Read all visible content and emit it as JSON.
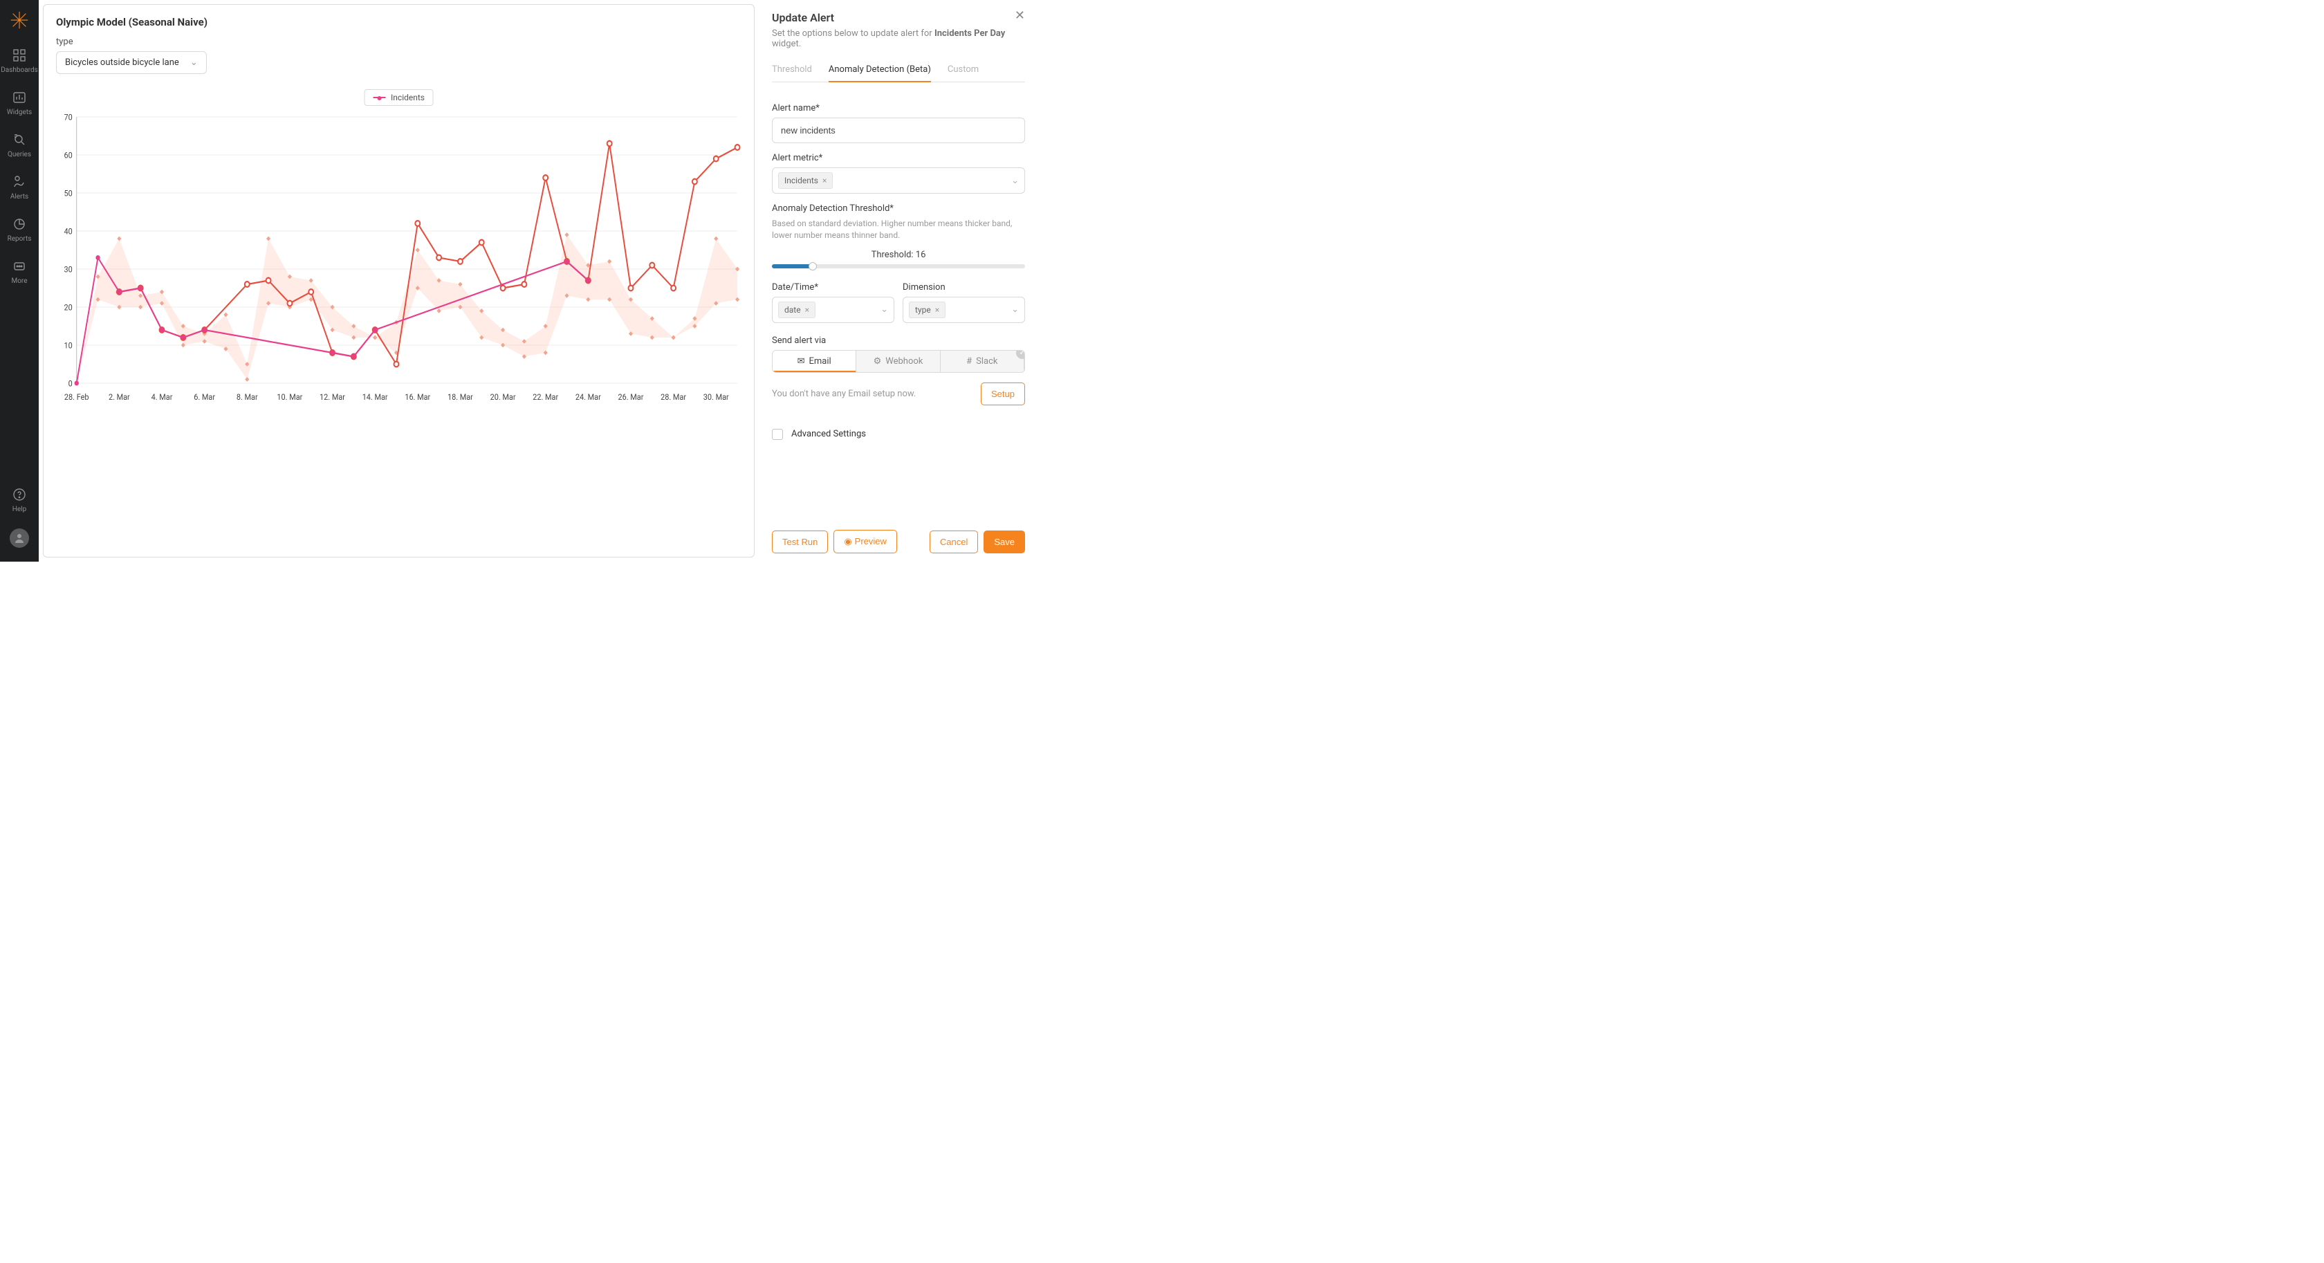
{
  "sidenav": {
    "items": [
      {
        "label": "Dashboards"
      },
      {
        "label": "Widgets"
      },
      {
        "label": "Queries"
      },
      {
        "label": "Alerts"
      },
      {
        "label": "Reports"
      },
      {
        "label": "More"
      }
    ],
    "help_label": "Help"
  },
  "chart_card": {
    "title": "Olympic Model (Seasonal Naive)",
    "filter_label": "type",
    "filter_value": "Bicycles outside bicycle lane",
    "legend_label": "Incidents"
  },
  "chart_data": {
    "type": "line",
    "xlabel": "",
    "ylabel": "",
    "ylim": [
      0,
      70
    ],
    "x_ticks": [
      "28. Feb",
      "2. Mar",
      "4. Mar",
      "6. Mar",
      "8. Mar",
      "10. Mar",
      "12. Mar",
      "14. Mar",
      "16. Mar",
      "18. Mar",
      "20. Mar",
      "22. Mar",
      "24. Mar",
      "26. Mar",
      "28. Mar",
      "30. Mar"
    ],
    "series": [
      {
        "name": "Incidents (forecast / anomaly)",
        "color": "#e64d3d",
        "style": "open-circle",
        "points": [
          {
            "x": "2. Mar",
            "y": 24
          },
          {
            "x": "3. Mar",
            "y": 25
          },
          {
            "x": "4. Mar",
            "y": 14
          },
          {
            "x": "5. Mar",
            "y": 12
          },
          {
            "x": "6. Mar",
            "y": 14
          },
          {
            "x": "8. Mar",
            "y": 26
          },
          {
            "x": "9. Mar",
            "y": 27
          },
          {
            "x": "10. Mar",
            "y": 21
          },
          {
            "x": "11. Mar",
            "y": 24
          },
          {
            "x": "12. Mar",
            "y": 8
          },
          {
            "x": "13. Mar",
            "y": 7
          },
          {
            "x": "14. Mar",
            "y": 14
          },
          {
            "x": "15. Mar",
            "y": 5
          },
          {
            "x": "16. Mar",
            "y": 42
          },
          {
            "x": "17. Mar",
            "y": 33
          },
          {
            "x": "18. Mar",
            "y": 32
          },
          {
            "x": "19. Mar",
            "y": 37
          },
          {
            "x": "20. Mar",
            "y": 25
          },
          {
            "x": "21. Mar",
            "y": 26
          },
          {
            "x": "22. Mar",
            "y": 54
          },
          {
            "x": "23. Mar",
            "y": 32
          },
          {
            "x": "24. Mar",
            "y": 27
          },
          {
            "x": "25. Mar",
            "y": 63
          },
          {
            "x": "26. Mar",
            "y": 25
          },
          {
            "x": "27. Mar",
            "y": 31
          },
          {
            "x": "28. Mar",
            "y": 25
          },
          {
            "x": "29. Mar",
            "y": 53
          },
          {
            "x": "30. Mar",
            "y": 59
          },
          {
            "x": "31. Mar",
            "y": 62
          }
        ]
      },
      {
        "name": "Incidents (actual)",
        "color": "#e83e8c",
        "style": "filled-circle",
        "points": [
          {
            "x": "28. Feb",
            "y": 0
          },
          {
            "x": "1. Mar",
            "y": 33
          },
          {
            "x": "2. Mar",
            "y": 24
          },
          {
            "x": "3. Mar",
            "y": 25
          },
          {
            "x": "4. Mar",
            "y": 14
          },
          {
            "x": "5. Mar",
            "y": 12
          },
          {
            "x": "6. Mar",
            "y": 14
          },
          {
            "x": "12. Mar",
            "y": 8
          },
          {
            "x": "13. Mar",
            "y": 7
          },
          {
            "x": "14. Mar",
            "y": 14
          },
          {
            "x": "23. Mar",
            "y": 32
          },
          {
            "x": "24. Mar",
            "y": 27
          }
        ]
      }
    ],
    "confidence_band": {
      "color": "rgba(255,150,120,0.18)",
      "upper": [
        {
          "x": "28. Feb",
          "y": 0
        },
        {
          "x": "1. Mar",
          "y": 28
        },
        {
          "x": "2. Mar",
          "y": 38
        },
        {
          "x": "3. Mar",
          "y": 23
        },
        {
          "x": "4. Mar",
          "y": 24
        },
        {
          "x": "5. Mar",
          "y": 15
        },
        {
          "x": "6. Mar",
          "y": 13
        },
        {
          "x": "7. Mar",
          "y": 18
        },
        {
          "x": "8. Mar",
          "y": 5
        },
        {
          "x": "9. Mar",
          "y": 38
        },
        {
          "x": "10. Mar",
          "y": 28
        },
        {
          "x": "11. Mar",
          "y": 27
        },
        {
          "x": "12. Mar",
          "y": 20
        },
        {
          "x": "13. Mar",
          "y": 15
        },
        {
          "x": "14. Mar",
          "y": 12
        },
        {
          "x": "15. Mar",
          "y": 16
        },
        {
          "x": "16. Mar",
          "y": 35
        },
        {
          "x": "17. Mar",
          "y": 27
        },
        {
          "x": "18. Mar",
          "y": 26
        },
        {
          "x": "19. Mar",
          "y": 19
        },
        {
          "x": "20. Mar",
          "y": 14
        },
        {
          "x": "21. Mar",
          "y": 11
        },
        {
          "x": "22. Mar",
          "y": 15
        },
        {
          "x": "23. Mar",
          "y": 39
        },
        {
          "x": "24. Mar",
          "y": 31
        },
        {
          "x": "25. Mar",
          "y": 32
        },
        {
          "x": "26. Mar",
          "y": 22
        },
        {
          "x": "27. Mar",
          "y": 17
        },
        {
          "x": "28. Mar",
          "y": 12
        },
        {
          "x": "29. Mar",
          "y": 17
        },
        {
          "x": "30. Mar",
          "y": 38
        },
        {
          "x": "31. Mar",
          "y": 30
        }
      ],
      "lower": [
        {
          "x": "28. Feb",
          "y": 0
        },
        {
          "x": "1. Mar",
          "y": 22
        },
        {
          "x": "2. Mar",
          "y": 20
        },
        {
          "x": "3. Mar",
          "y": 20
        },
        {
          "x": "4. Mar",
          "y": 21
        },
        {
          "x": "5. Mar",
          "y": 10
        },
        {
          "x": "6. Mar",
          "y": 11
        },
        {
          "x": "7. Mar",
          "y": 9
        },
        {
          "x": "8. Mar",
          "y": 1
        },
        {
          "x": "9. Mar",
          "y": 21
        },
        {
          "x": "10. Mar",
          "y": 20
        },
        {
          "x": "11. Mar",
          "y": 22
        },
        {
          "x": "12. Mar",
          "y": 14
        },
        {
          "x": "13. Mar",
          "y": 12
        },
        {
          "x": "14. Mar",
          "y": 12
        },
        {
          "x": "15. Mar",
          "y": 8
        },
        {
          "x": "16. Mar",
          "y": 25
        },
        {
          "x": "17. Mar",
          "y": 19
        },
        {
          "x": "18. Mar",
          "y": 20
        },
        {
          "x": "19. Mar",
          "y": 12
        },
        {
          "x": "20. Mar",
          "y": 10
        },
        {
          "x": "21. Mar",
          "y": 7
        },
        {
          "x": "22. Mar",
          "y": 8
        },
        {
          "x": "23. Mar",
          "y": 23
        },
        {
          "x": "24. Mar",
          "y": 22
        },
        {
          "x": "25. Mar",
          "y": 22
        },
        {
          "x": "26. Mar",
          "y": 13
        },
        {
          "x": "27. Mar",
          "y": 12
        },
        {
          "x": "28. Mar",
          "y": 12
        },
        {
          "x": "29. Mar",
          "y": 15
        },
        {
          "x": "30. Mar",
          "y": 21
        },
        {
          "x": "31. Mar",
          "y": 22
        }
      ]
    }
  },
  "panel": {
    "title": "Update Alert",
    "subtitle_pre": "Set the options below to update alert for ",
    "subtitle_bold": "Incidents Per Day",
    "subtitle_post": " widget.",
    "tabs": [
      "Threshold",
      "Anomaly Detection (Beta)",
      "Custom"
    ],
    "active_tab": 1,
    "alert_name_label": "Alert name*",
    "alert_name_value": "new incidents",
    "alert_metric_label": "Alert metric*",
    "alert_metric_value": "Incidents",
    "threshold_label": "Anomaly Detection Threshold*",
    "threshold_hint": "Based on standard deviation. Higher number means thicker band, lower number means thinner band.",
    "threshold_caption": "Threshold: 16",
    "date_label": "Date/Time*",
    "date_value": "date",
    "dimension_label": "Dimension",
    "dimension_value": "type",
    "send_via_label": "Send alert via",
    "send_via_options": [
      "Email",
      "Webhook",
      "Slack"
    ],
    "send_via_active": 0,
    "no_email_msg": "You don't have any Email setup now.",
    "setup_btn": "Setup",
    "advanced_label": "Advanced Settings",
    "footer": {
      "test_run": "Test Run",
      "preview": "Preview",
      "cancel": "Cancel",
      "save": "Save"
    }
  }
}
